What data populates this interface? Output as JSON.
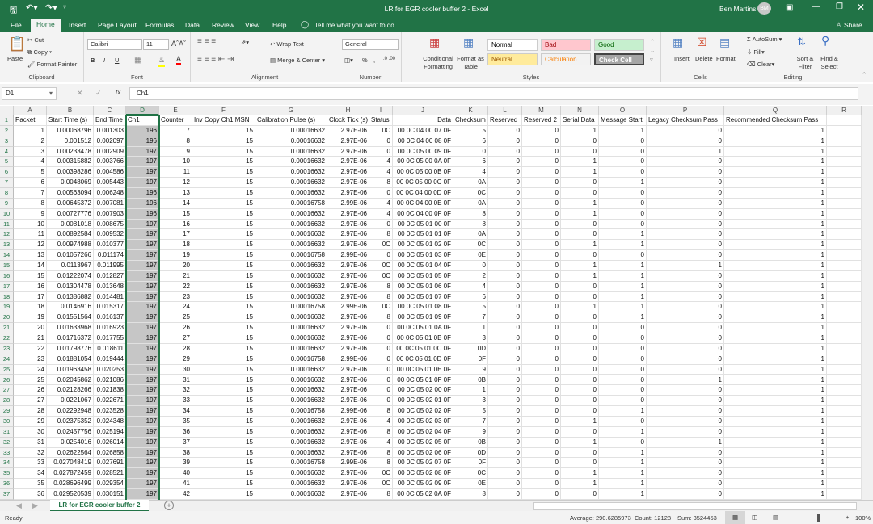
{
  "window": {
    "title": "LR for EGR cooler buffer 2  -  Excel",
    "user": "Ben Martins",
    "avatar": "BM",
    "share": "Share"
  },
  "menu": {
    "tabs": [
      "File",
      "Home",
      "Insert",
      "Page Layout",
      "Formulas",
      "Data",
      "Review",
      "View",
      "Help"
    ],
    "active": "Home",
    "tell_me": "Tell me what you want to do"
  },
  "ribbon": {
    "clipboard": {
      "label": "Clipboard",
      "paste": "Paste",
      "cut": "Cut",
      "copy": "Copy",
      "format_painter": "Format Painter"
    },
    "font": {
      "label": "Font",
      "name": "Calibri",
      "size": "11",
      "bold": "B",
      "italic": "I",
      "underline": "U",
      "font_color": "#ff0000",
      "fill_color": "#ffff00"
    },
    "alignment": {
      "label": "Alignment",
      "wrap": "Wrap Text",
      "merge": "Merge & Center"
    },
    "number": {
      "label": "Number",
      "format": "General",
      "percent": "%",
      "comma": ","
    },
    "styles": {
      "label": "Styles",
      "conditional": "Conditional Formatting",
      "format_table": "Format as Table",
      "cells": [
        {
          "name": "Normal",
          "bg": "#ffffff",
          "fg": "#000000"
        },
        {
          "name": "Bad",
          "bg": "#ffc7ce",
          "fg": "#9c0006"
        },
        {
          "name": "Good",
          "bg": "#c6efce",
          "fg": "#006100"
        },
        {
          "name": "Neutral",
          "bg": "#ffeb9c",
          "fg": "#9c5700"
        },
        {
          "name": "Calculation",
          "bg": "#f2f2f2",
          "fg": "#fa7d00"
        },
        {
          "name": "Check Cell",
          "bg": "#a5a5a5",
          "fg": "#ffffff"
        }
      ]
    },
    "cells": {
      "label": "Cells",
      "insert": "Insert",
      "delete": "Delete",
      "format": "Format"
    },
    "editing": {
      "label": "Editing",
      "autosum": "AutoSum",
      "fill": "Fill",
      "clear": "Clear",
      "sort": "Sort & Filter",
      "find": "Find & Select"
    }
  },
  "formula_bar": {
    "name_box": "D1",
    "fx": "fx",
    "value": "Ch1"
  },
  "sheet": {
    "columns": [
      "A",
      "B",
      "C",
      "D",
      "E",
      "F",
      "G",
      "H",
      "I",
      "J",
      "K",
      "L",
      "M",
      "N",
      "O",
      "P",
      "Q",
      "R"
    ],
    "selected_column": "D",
    "headers": [
      "Packet",
      "Start Time (s)",
      "End Time",
      "Ch1",
      "Counter",
      "Inv Copy Ch1 MSN",
      "Calibration Pulse (s)",
      "Clock Tick (s)",
      "Status",
      "Data",
      "Checksum",
      "Reserved",
      "Reserved 2",
      "Serial Data",
      "Message Start",
      "Legacy Checksum Pass",
      "Recommended Checksum Pass"
    ],
    "rows": [
      [
        "1",
        "0.00068796",
        "0.001303",
        "196",
        "7",
        "15",
        "0.00016632",
        "2.97E-06",
        "0C",
        "00 0C 04 00 07 0F",
        "5",
        "0",
        "0",
        "1",
        "1",
        "0",
        "1"
      ],
      [
        "2",
        "0.001512",
        "0.002097",
        "196",
        "8",
        "15",
        "0.00016632",
        "2.97E-06",
        "0",
        "00 0C 04 00 08 0F",
        "6",
        "0",
        "0",
        "0",
        "0",
        "0",
        "1"
      ],
      [
        "3",
        "0.00233478",
        "0.002909",
        "197",
        "9",
        "15",
        "0.00016632",
        "2.97E-06",
        "0",
        "00 0C 05 00 09 0F",
        "0",
        "0",
        "0",
        "0",
        "0",
        "1",
        "1"
      ],
      [
        "4",
        "0.00315882",
        "0.003766",
        "197",
        "10",
        "15",
        "0.00016632",
        "2.97E-06",
        "4",
        "00 0C 05 00 0A 0F",
        "6",
        "0",
        "0",
        "1",
        "0",
        "0",
        "1"
      ],
      [
        "5",
        "0.00398286",
        "0.004586",
        "197",
        "11",
        "15",
        "0.00016632",
        "2.97E-06",
        "4",
        "00 0C 05 00 0B 0F",
        "4",
        "0",
        "0",
        "1",
        "0",
        "0",
        "1"
      ],
      [
        "6",
        "0.0048069",
        "0.005443",
        "197",
        "12",
        "15",
        "0.00016632",
        "2.97E-06",
        "8",
        "00 0C 05 00 0C 0F",
        "0A",
        "0",
        "0",
        "0",
        "1",
        "0",
        "1"
      ],
      [
        "7",
        "0.00563094",
        "0.006248",
        "196",
        "13",
        "15",
        "0.00016632",
        "2.97E-06",
        "0",
        "00 0C 04 00 0D 0F",
        "0C",
        "0",
        "0",
        "0",
        "0",
        "0",
        "1"
      ],
      [
        "8",
        "0.00645372",
        "0.007081",
        "196",
        "14",
        "15",
        "0.00016758",
        "2.99E-06",
        "4",
        "00 0C 04 00 0E 0F",
        "0A",
        "0",
        "0",
        "1",
        "0",
        "0",
        "1"
      ],
      [
        "9",
        "0.00727776",
        "0.007903",
        "196",
        "15",
        "15",
        "0.00016632",
        "2.97E-06",
        "4",
        "00 0C 04 00 0F 0F",
        "8",
        "0",
        "0",
        "1",
        "0",
        "0",
        "1"
      ],
      [
        "10",
        "0.0081018",
        "0.008675",
        "197",
        "16",
        "15",
        "0.00016632",
        "2.97E-06",
        "0",
        "00 0C 05 01 00 0F",
        "8",
        "0",
        "0",
        "0",
        "0",
        "0",
        "1"
      ],
      [
        "11",
        "0.00892584",
        "0.009532",
        "197",
        "17",
        "15",
        "0.00016632",
        "2.97E-06",
        "8",
        "00 0C 05 01 01 0F",
        "0A",
        "0",
        "0",
        "0",
        "1",
        "0",
        "1"
      ],
      [
        "12",
        "0.00974988",
        "0.010377",
        "197",
        "18",
        "15",
        "0.00016632",
        "2.97E-06",
        "0C",
        "00 0C 05 01 02 0F",
        "0C",
        "0",
        "0",
        "1",
        "1",
        "0",
        "1"
      ],
      [
        "13",
        "0.01057266",
        "0.011174",
        "197",
        "19",
        "15",
        "0.00016758",
        "2.99E-06",
        "0",
        "00 0C 05 01 03 0F",
        "0E",
        "0",
        "0",
        "0",
        "0",
        "0",
        "1"
      ],
      [
        "14",
        "0.0113967",
        "0.011995",
        "197",
        "20",
        "15",
        "0.00016632",
        "2.97E-06",
        "0C",
        "00 0C 05 01 04 0F",
        "0",
        "0",
        "0",
        "1",
        "1",
        "1",
        "1"
      ],
      [
        "15",
        "0.01222074",
        "0.012827",
        "197",
        "21",
        "15",
        "0.00016632",
        "2.97E-06",
        "0C",
        "00 0C 05 01 05 0F",
        "2",
        "0",
        "0",
        "1",
        "1",
        "0",
        "1"
      ],
      [
        "16",
        "0.01304478",
        "0.013648",
        "197",
        "22",
        "15",
        "0.00016632",
        "2.97E-06",
        "8",
        "00 0C 05 01 06 0F",
        "4",
        "0",
        "0",
        "0",
        "1",
        "0",
        "1"
      ],
      [
        "17",
        "0.01386882",
        "0.014481",
        "197",
        "23",
        "15",
        "0.00016632",
        "2.97E-06",
        "8",
        "00 0C 05 01 07 0F",
        "6",
        "0",
        "0",
        "0",
        "1",
        "0",
        "1"
      ],
      [
        "18",
        "0.0146916",
        "0.015317",
        "197",
        "24",
        "15",
        "0.00016758",
        "2.99E-06",
        "0C",
        "00 0C 05 01 08 0F",
        "5",
        "0",
        "0",
        "1",
        "1",
        "0",
        "1"
      ],
      [
        "19",
        "0.01551564",
        "0.016137",
        "197",
        "25",
        "15",
        "0.00016632",
        "2.97E-06",
        "8",
        "00 0C 05 01 09 0F",
        "7",
        "0",
        "0",
        "0",
        "1",
        "0",
        "1"
      ],
      [
        "20",
        "0.01633968",
        "0.016923",
        "197",
        "26",
        "15",
        "0.00016632",
        "2.97E-06",
        "0",
        "00 0C 05 01 0A 0F",
        "1",
        "0",
        "0",
        "0",
        "0",
        "0",
        "1"
      ],
      [
        "21",
        "0.01716372",
        "0.017755",
        "197",
        "27",
        "15",
        "0.00016632",
        "2.97E-06",
        "0",
        "00 0C 05 01 0B 0F",
        "3",
        "0",
        "0",
        "0",
        "0",
        "0",
        "1"
      ],
      [
        "22",
        "0.01798776",
        "0.018611",
        "197",
        "28",
        "15",
        "0.00016632",
        "2.97E-06",
        "0",
        "00 0C 05 01 0C 0F",
        "0D",
        "0",
        "0",
        "0",
        "0",
        "0",
        "1"
      ],
      [
        "23",
        "0.01881054",
        "0.019444",
        "197",
        "29",
        "15",
        "0.00016758",
        "2.99E-06",
        "0",
        "00 0C 05 01 0D 0F",
        "0F",
        "0",
        "0",
        "0",
        "0",
        "0",
        "1"
      ],
      [
        "24",
        "0.01963458",
        "0.020253",
        "197",
        "30",
        "15",
        "0.00016632",
        "2.97E-06",
        "0",
        "00 0C 05 01 0E 0F",
        "9",
        "0",
        "0",
        "0",
        "0",
        "0",
        "1"
      ],
      [
        "25",
        "0.02045862",
        "0.021086",
        "197",
        "31",
        "15",
        "0.00016632",
        "2.97E-06",
        "0",
        "00 0C 05 01 0F 0F",
        "0B",
        "0",
        "0",
        "0",
        "0",
        "1",
        "1"
      ],
      [
        "26",
        "0.02128266",
        "0.021838",
        "197",
        "32",
        "15",
        "0.00016632",
        "2.97E-06",
        "0",
        "00 0C 05 02 00 0F",
        "1",
        "0",
        "0",
        "0",
        "0",
        "0",
        "1"
      ],
      [
        "27",
        "0.0221067",
        "0.022671",
        "197",
        "33",
        "15",
        "0.00016632",
        "2.97E-06",
        "0",
        "00 0C 05 02 01 0F",
        "3",
        "0",
        "0",
        "0",
        "0",
        "0",
        "1"
      ],
      [
        "28",
        "0.02292948",
        "0.023528",
        "197",
        "34",
        "15",
        "0.00016758",
        "2.99E-06",
        "8",
        "00 0C 05 02 02 0F",
        "5",
        "0",
        "0",
        "0",
        "1",
        "0",
        "1"
      ],
      [
        "29",
        "0.02375352",
        "0.024348",
        "197",
        "35",
        "15",
        "0.00016632",
        "2.97E-06",
        "4",
        "00 0C 05 02 03 0F",
        "7",
        "0",
        "0",
        "1",
        "0",
        "0",
        "1"
      ],
      [
        "30",
        "0.02457756",
        "0.025194",
        "197",
        "36",
        "15",
        "0.00016632",
        "2.97E-06",
        "8",
        "00 0C 05 02 04 0F",
        "9",
        "0",
        "0",
        "0",
        "1",
        "0",
        "1"
      ],
      [
        "31",
        "0.0254016",
        "0.026014",
        "197",
        "37",
        "15",
        "0.00016632",
        "2.97E-06",
        "4",
        "00 0C 05 02 05 0F",
        "0B",
        "0",
        "0",
        "1",
        "0",
        "1",
        "1"
      ],
      [
        "32",
        "0.02622564",
        "0.026858",
        "197",
        "38",
        "15",
        "0.00016632",
        "2.97E-06",
        "8",
        "00 0C 05 02 06 0F",
        "0D",
        "0",
        "0",
        "0",
        "1",
        "0",
        "1"
      ],
      [
        "33",
        "0.027048419",
        "0.027691",
        "197",
        "39",
        "15",
        "0.00016758",
        "2.99E-06",
        "8",
        "00 0C 05 02 07 0F",
        "0F",
        "0",
        "0",
        "0",
        "1",
        "0",
        "1"
      ],
      [
        "34",
        "0.027872459",
        "0.028521",
        "197",
        "40",
        "15",
        "0.00016632",
        "2.97E-06",
        "0C",
        "00 0C 05 02 08 0F",
        "0C",
        "0",
        "0",
        "1",
        "1",
        "0",
        "1"
      ],
      [
        "35",
        "0.028696499",
        "0.029354",
        "197",
        "41",
        "15",
        "0.00016632",
        "2.97E-06",
        "0C",
        "00 0C 05 02 09 0F",
        "0E",
        "0",
        "0",
        "1",
        "1",
        "0",
        "1"
      ],
      [
        "36",
        "0.029520539",
        "0.030151",
        "197",
        "42",
        "15",
        "0.00016632",
        "2.97E-06",
        "8",
        "00 0C 05 02 0A 0F",
        "8",
        "0",
        "0",
        "0",
        "1",
        "0",
        "1"
      ]
    ]
  },
  "sheet_tabs": {
    "active": "LR for EGR cooler buffer 2",
    "add": "+"
  },
  "status": {
    "ready": "Ready",
    "average": "Average: 290.6285973",
    "count": "Count: 12128",
    "sum": "Sum: 3524453",
    "zoom": "100%",
    "zoom_percent": 100
  },
  "colors": {
    "accent": "#217346",
    "selected_column": "#c6c6c6"
  }
}
